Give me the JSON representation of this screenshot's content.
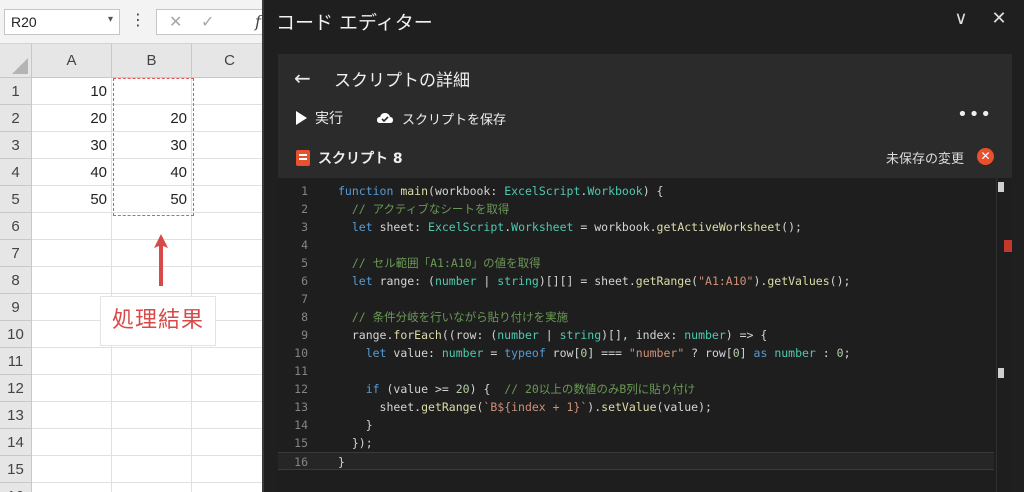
{
  "excel": {
    "name_box": "R20",
    "columns": [
      "A",
      "B",
      "C"
    ],
    "rows": [
      "1",
      "2",
      "3",
      "4",
      "5",
      "6",
      "7",
      "8",
      "9",
      "10",
      "11",
      "12",
      "13",
      "14",
      "15",
      "16"
    ],
    "col_a": [
      "10",
      "20",
      "30",
      "40",
      "50"
    ],
    "col_b": [
      "",
      "20",
      "30",
      "40",
      "50"
    ],
    "callout": "処理結果"
  },
  "editor": {
    "title": "コード エディター",
    "details_title": "スクリプトの詳細",
    "run_label": "実行",
    "save_label": "スクリプトを保存",
    "more": "•••",
    "script_name": "スクリプト 8",
    "unsaved_label": "未保存の変更",
    "code_lines": [
      "function main(workbook: ExcelScript.Workbook) {",
      "  // アクティブなシートを取得",
      "  let sheet: ExcelScript.Worksheet = workbook.getActiveWorksheet();",
      "",
      "  // セル範囲「A1:A10」の値を取得",
      "  let range: (number | string)[][] = sheet.getRange(\"A1:A10\").getValues();",
      "",
      "  // 条件分岐を行いながら貼り付けを実施",
      "  range.forEach((row: (number | string)[], index: number) => {",
      "    let value: number = typeof row[0] === \"number\" ? row[0] as number : 0;",
      "",
      "    if (value >= 20) {  // 20以上の数値のみB列に貼り付け",
      "      sheet.getRange(`B${index + 1}`).setValue(value);",
      "    }",
      "  });",
      "}"
    ]
  },
  "colors": {
    "accent_red": "#e05a5a",
    "editor_bg": "#1f1f1f",
    "keyword": "#569cd6",
    "type": "#4ec9b0",
    "comment": "#6a9955",
    "string": "#ce9178"
  }
}
